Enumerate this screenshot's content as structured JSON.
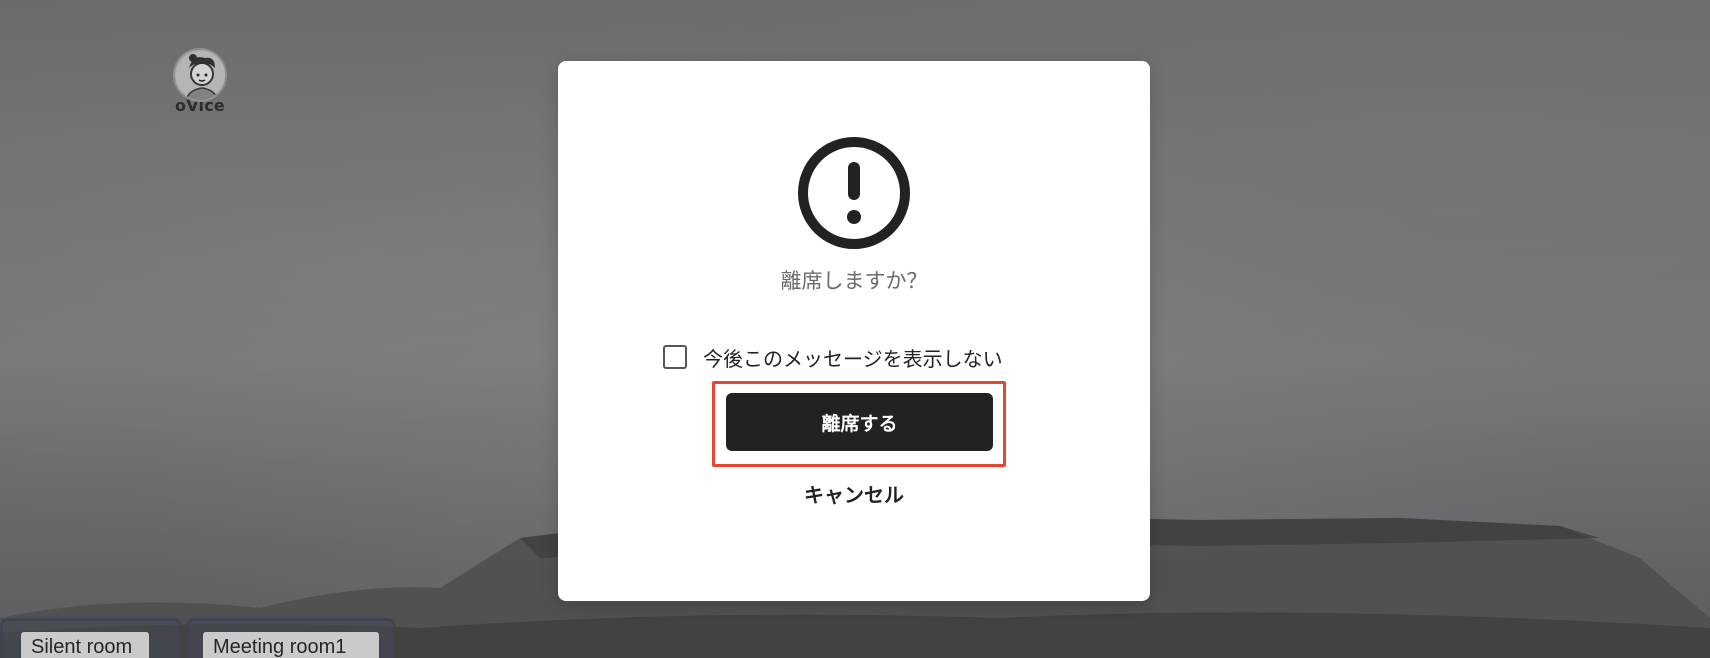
{
  "background": {
    "avatar": {
      "name": "oVice",
      "icon": "user-avatar-icon"
    },
    "rooms": [
      {
        "label": "Silent room"
      },
      {
        "label": "Meeting room1"
      }
    ]
  },
  "dialog": {
    "icon": "exclamation-circle-icon",
    "message": "離席しますか？",
    "checkbox_label": "今後このメッセージを表示しない",
    "checkbox_checked": false,
    "confirm_label": "離席する",
    "cancel_label": "キャンセル"
  },
  "colors": {
    "primary_button": "#222222",
    "highlight_border": "#e64630",
    "dialog_background": "#ffffff"
  }
}
